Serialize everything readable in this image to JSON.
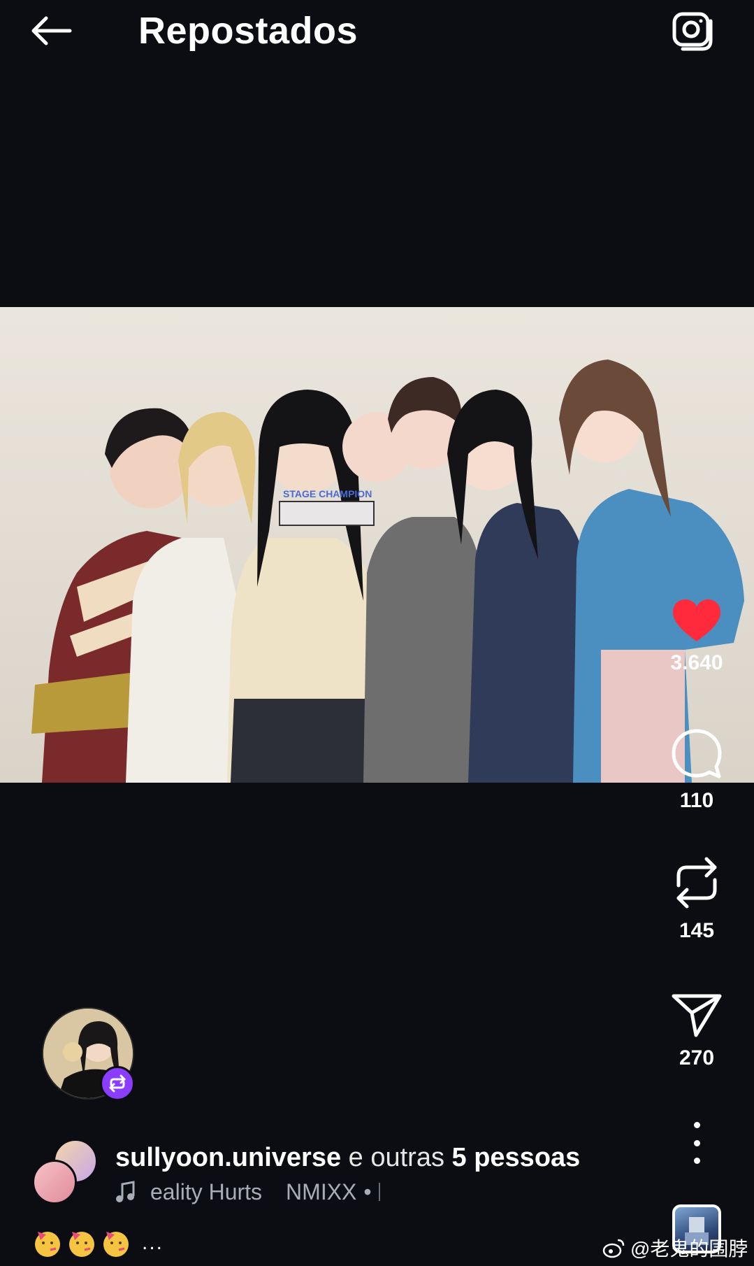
{
  "header": {
    "title": "Repostados",
    "back_icon": "arrow-left-icon",
    "camera_icon": "camera-icon"
  },
  "post": {
    "photo_description_icon": "group-photo",
    "trophy_text": "STAGE CHAMPION"
  },
  "actions": {
    "likes": "3.640",
    "comments": "110",
    "reposts": "145",
    "shares": "270",
    "like_color": "#ff2a3c"
  },
  "author": {
    "repost_badge_color": "#8a3cff"
  },
  "reposters": {
    "username": "sullyoon.universe",
    "middle": " e outras ",
    "others": "5 pessoas"
  },
  "music": {
    "title": "eality Hurts",
    "artist": "NMIXX",
    "separator": "•"
  },
  "caption": {
    "more": "..."
  },
  "watermark": {
    "text": "@老鬼的围脖"
  }
}
